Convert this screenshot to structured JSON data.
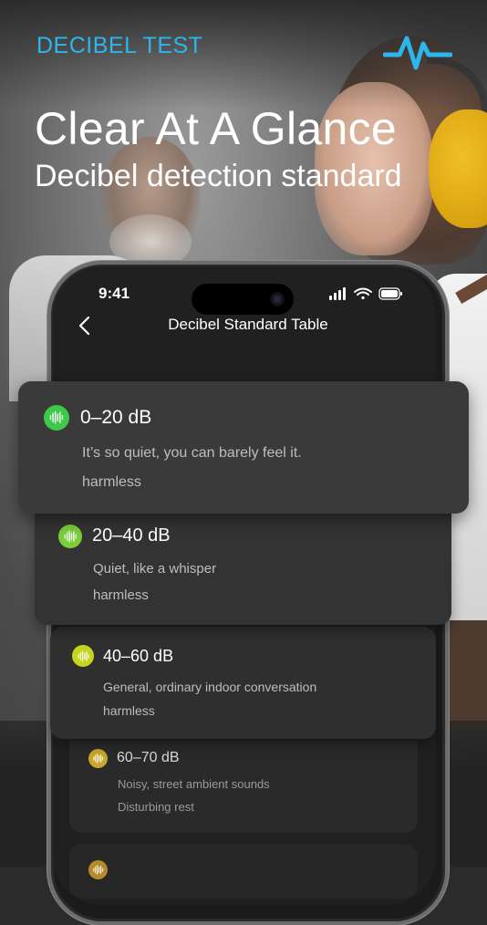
{
  "header": {
    "brand": "DECIBEL TEST",
    "headline": "Clear At A Glance",
    "subheadline": "Decibel detection standard",
    "accent_color": "#2bb6ec"
  },
  "phone": {
    "status_time": "9:41",
    "screen_title": "Decibel Standard Table"
  },
  "levels": [
    {
      "range": "0–20 dB",
      "description": "It’s so quiet, you can barely feel it.",
      "effect": "harmless",
      "color": "#3ec94a"
    },
    {
      "range": "20–40 dB",
      "description": "Quiet, like a whisper",
      "effect": "harmless",
      "color": "#7ccd3a"
    },
    {
      "range": "40–60 dB",
      "description": "General, ordinary indoor conversation",
      "effect": "harmless",
      "color": "#c5d41f"
    },
    {
      "range": "60–70 dB",
      "description": "Noisy, street ambient sounds",
      "effect": "Disturbing rest",
      "color": "#c9a72a"
    },
    {
      "color": "#b58a2a"
    }
  ],
  "icons": {
    "brand": "waveform-icon",
    "back": "chevron-left-icon",
    "level": "sound-wave-icon"
  }
}
